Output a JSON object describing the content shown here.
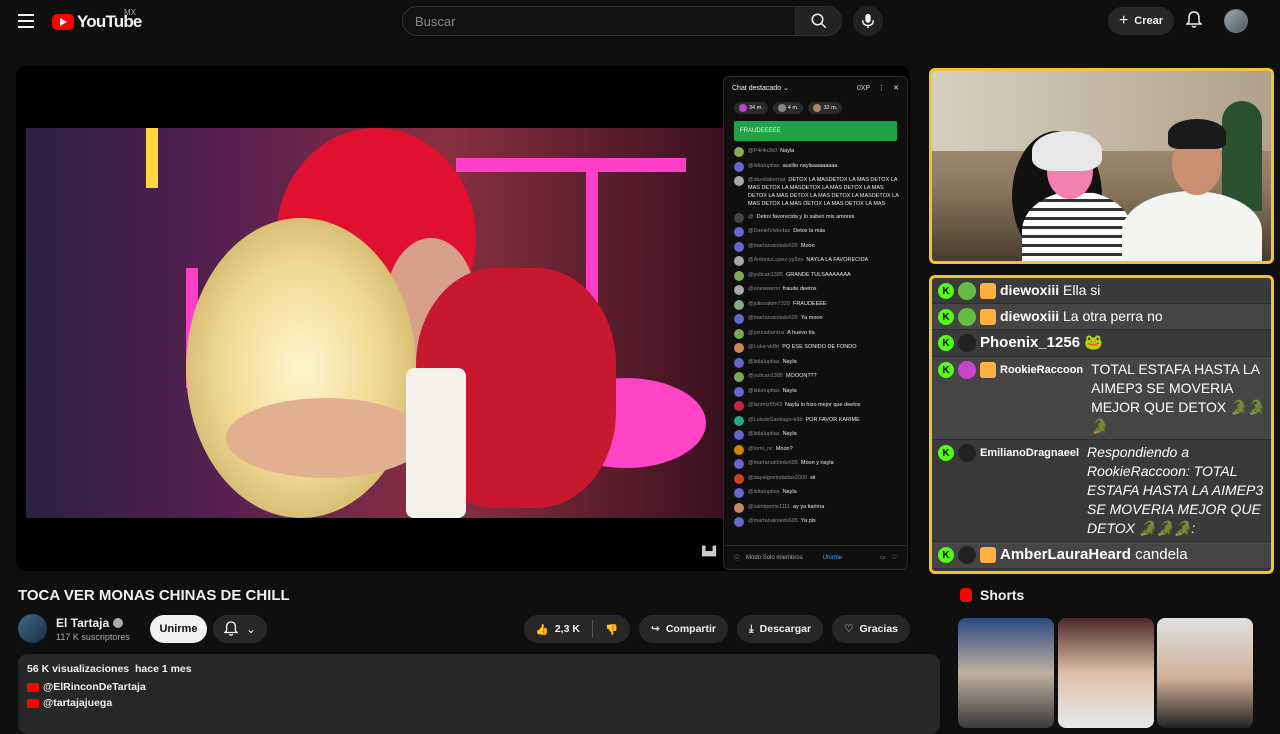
{
  "header": {
    "logo_text": "YouTube",
    "region": "MX",
    "search_placeholder": "Buscar",
    "create_label": "Crear"
  },
  "video": {
    "title": "TOCA VER MONAS CHINAS DE CHILL",
    "channel": "El Tartaja",
    "subscribers": "117 K suscriptores",
    "join_label": "Unirme",
    "likes": "2,3 K",
    "share_label": "Compartir",
    "download_label": "Descargar",
    "thanks_label": "Gracias"
  },
  "description": {
    "views": "56 K visualizaciones",
    "date": "hace 1 mes",
    "links": [
      "@ElRinconDeTartaja",
      "@tartajajuega"
    ]
  },
  "shorts": {
    "title": "Shorts"
  },
  "yt_chat": {
    "title": "Chat destacado",
    "xp": "0XP",
    "pills": [
      "34 m.",
      "4 m.",
      "32 m."
    ],
    "pinned": "FRAUDEEEEE",
    "footer_mode": "Modo Solo miembros",
    "footer_join": "Unirme",
    "messages": [
      {
        "user": "@P4r4n3k0",
        "text": "Nayla",
        "color": "#8a5"
      },
      {
        "user": "@lidiaIupitas",
        "text": "auxilio naylaaaaaaaaa",
        "color": "#66c"
      },
      {
        "user": "@davidabernaI",
        "text": "DETOX LA MASDETOX LA MAS DETOX LA MAS DETOX LA MASDETOX LA MAS DETOX LA MAS DETOX LA MAS DETOX LA MAS DETOX LA MASDETOX LA MAS DETOX LA MAS DETOX LA MAS DETOX LA MAS",
        "color": "#aaa"
      },
      {
        "user": "@",
        "text": "Detox favorecida y lo saben mis amores",
        "color": "#444"
      },
      {
        "user": "@DanielVieledaz",
        "text": "Detox la más",
        "color": "#66c"
      },
      {
        "user": "@martanatoledo695",
        "text": "Moon",
        "color": "#66c"
      },
      {
        "user": "@AntonioLopez-yy9zo",
        "text": "NAYLA LA FAVORECIDA",
        "color": "#aaa"
      },
      {
        "user": "@yulican1385",
        "text": "GRANDE TULSAAAAAAA",
        "color": "#7a5"
      },
      {
        "user": "@anewwerst",
        "text": "fraude deetox",
        "color": "#aaa"
      },
      {
        "user": "@juliosakim7329",
        "text": "FRAUDEEEE",
        "color": "#8a8"
      },
      {
        "user": "@martanatoledo695",
        "text": "Ya moon",
        "color": "#66c"
      },
      {
        "user": "@pizzadiantza",
        "text": "A huevo tía",
        "color": "#7a5"
      },
      {
        "user": "@Luka-vk8rt",
        "text": "PQ ESE SONIDO DE FONDO",
        "color": "#c85"
      },
      {
        "user": "@lidiaIupitas",
        "text": "Nayla",
        "color": "#66c"
      },
      {
        "user": "@yulican1385",
        "text": "MOOON???",
        "color": "#7a5"
      },
      {
        "user": "@lidiaIupitas",
        "text": "Nayla",
        "color": "#66c"
      },
      {
        "user": "@lanmtz5543",
        "text": "Nayla lo hizo mejor que deetox",
        "color": "#c24"
      },
      {
        "user": "@LuisdeSantiago-b9b",
        "text": "POR FAVOR KARIME",
        "color": "#2a8"
      },
      {
        "user": "@lidiaIupitas",
        "text": "Nayla",
        "color": "#66c"
      },
      {
        "user": "@tomi_nc",
        "text": "Moon?",
        "color": "#c80"
      },
      {
        "user": "@martanatoledo695",
        "text": "Moon y nayla",
        "color": "#66c"
      },
      {
        "user": "@dayalgovindadas2000",
        "text": "sii",
        "color": "#c42"
      },
      {
        "user": "@lidiaIupitas",
        "text": "Nayla",
        "color": "#66c"
      },
      {
        "user": "@saintpeme1111",
        "text": "ay ya karima",
        "color": "#c86"
      },
      {
        "user": "@martanatoledo695",
        "text": "Ya pls",
        "color": "#66c"
      }
    ]
  },
  "kick_chat": [
    {
      "user": "diewoxiii",
      "text": "Ella si",
      "size": "mid",
      "badge_color": "#6b4"
    },
    {
      "user": "diewoxiii",
      "text": "La otra perra no",
      "size": "mid",
      "badge_color": "#6b4"
    },
    {
      "user": "Phoenix_1256",
      "text": "🐸",
      "size": "big",
      "badge_color": "#222"
    },
    {
      "user": "RookieRaccoon",
      "text": "TOTAL ESTAFA HASTA LA AIMEP3 SE MOVERIA MEJOR QUE DETOX 🐊🐊🐊",
      "size": "small",
      "badge_color": "#c4c"
    },
    {
      "user": "EmilianoDragnaeel",
      "text": "Respondiendo a RookieRaccoon: TOTAL ESTAFA HASTA LA AIMEP3 SE MOVERIA MEJOR QUE DETOX 🐊🐊🐊:",
      "size": "small",
      "badge_color": "#222"
    },
    {
      "user": "AmberLauraHeard",
      "text": "candela",
      "size": "big",
      "badge_color": "#222"
    }
  ],
  "colors": {
    "accent_yellow": "#f4c430",
    "kick_green": "#53fc18",
    "yt_red": "#ff0000"
  }
}
